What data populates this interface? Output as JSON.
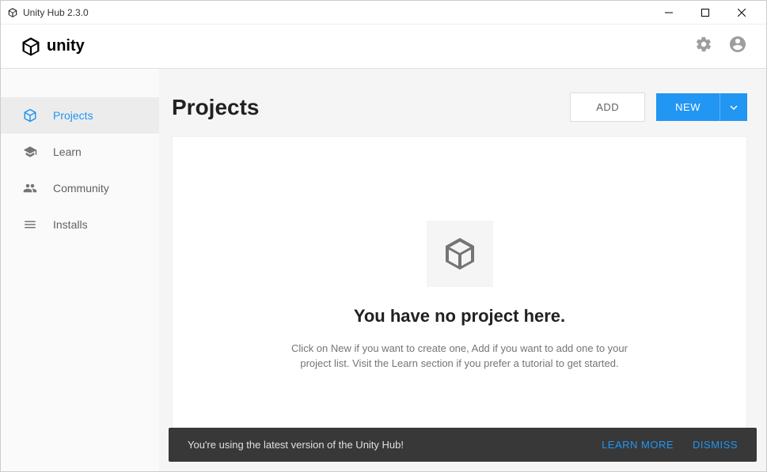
{
  "window": {
    "title": "Unity Hub 2.3.0"
  },
  "header": {
    "logo_text": "unity"
  },
  "sidebar": {
    "items": [
      {
        "label": "Projects",
        "active": true
      },
      {
        "label": "Learn",
        "active": false
      },
      {
        "label": "Community",
        "active": false
      },
      {
        "label": "Installs",
        "active": false
      }
    ]
  },
  "main": {
    "title": "Projects",
    "add_button": "ADD",
    "new_button": "NEW",
    "empty": {
      "title": "You have no project here.",
      "description": "Click on New if you want to create one, Add if you want to add one to your project list. Visit the Learn section if you prefer a tutorial to get started."
    }
  },
  "toast": {
    "message": "You're using the latest version of the Unity Hub!",
    "learn_more": "LEARN MORE",
    "dismiss": "DISMISS"
  },
  "colors": {
    "primary": "#2196f3",
    "text_dark": "#212121",
    "text_muted": "#757575",
    "toast_bg": "#383838"
  }
}
